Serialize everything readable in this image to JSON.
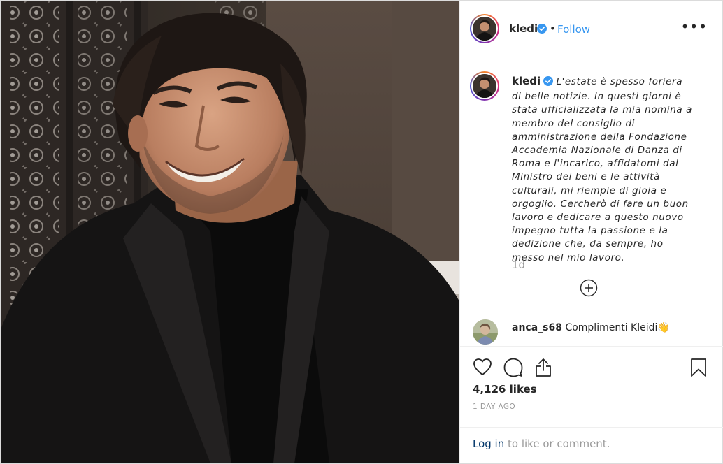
{
  "post": {
    "username": "kledi",
    "follow_label": "Follow",
    "dot": "•",
    "more_glyph": "•••",
    "caption": "L'estate è spesso foriera di belle notizie. In questi giorni è stata ufficializzata la mia nomina a membro del consiglio di amministrazione della Fondazione Accademia Nazionale di Danza di Roma e l'incarico, affidatomi dal Ministro dei beni e le attività culturali, mi riempie di gioia e orgoglio. Cercherò di fare un buon lavoro e dedicare a questo nuovo impegno tutta la passione e la dedizione che, da sempre, ho messo nel mio lavoro.",
    "caption_age": "1d",
    "likes": "4,126 likes",
    "date": "1 DAY AGO"
  },
  "comments": [
    {
      "username": "anca_s68",
      "text": "Complimenti Kleidi👋"
    }
  ],
  "login": {
    "link": "Log in",
    "rest": " to like or comment."
  },
  "icons": {
    "verified": "verified-badge-icon",
    "more": "more-options-icon",
    "load_more": "plus-circle-icon",
    "like": "heart-icon",
    "comment": "comment-bubble-icon",
    "share": "share-icon",
    "save": "bookmark-icon"
  },
  "colors": {
    "link_blue": "#3897f0",
    "verified_blue": "#3897f0",
    "muted_gray": "#999999",
    "login_link": "#003569"
  }
}
